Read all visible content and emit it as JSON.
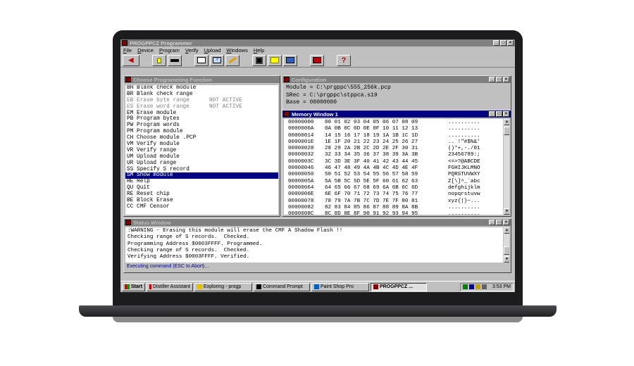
{
  "app": {
    "title": "PROGPPCZ Programmer",
    "menu": [
      "File",
      "Device",
      "Program",
      "Verify",
      "Upload",
      "Windows",
      "Help"
    ]
  },
  "toolbar": {
    "icons": [
      "back-arrow-icon",
      "bulb-icon",
      "bar-icon",
      "monitor-icon",
      "monitor-help-icon",
      "pencil-icon",
      "save-icon",
      "folder-open-icon",
      "transfer-icon",
      "export-icon",
      "help-icon"
    ]
  },
  "functions": {
    "title": "Choose Programming Function",
    "items": [
      {
        "text": "BH Blank check module",
        "state": "enabled"
      },
      {
        "text": "BR Blank check range",
        "state": "enabled"
      },
      {
        "text": "EB Erase byte range      NOT ACTIVE",
        "state": "disabled"
      },
      {
        "text": "ES Erase word range      NOT ACTIVE",
        "state": "disabled"
      },
      {
        "text": "EM Erase module",
        "state": "enabled"
      },
      {
        "text": "PB Program bytes",
        "state": "enabled"
      },
      {
        "text": "PW Program words",
        "state": "enabled"
      },
      {
        "text": "PM Program module",
        "state": "enabled"
      },
      {
        "text": "CH Choose module .PCP",
        "state": "enabled"
      },
      {
        "text": "VM Verify module",
        "state": "enabled"
      },
      {
        "text": "VR Verify range",
        "state": "enabled"
      },
      {
        "text": "UM Upload module",
        "state": "enabled"
      },
      {
        "text": "UR Upload range",
        "state": "enabled"
      },
      {
        "text": "SS Specify S record",
        "state": "enabled"
      },
      {
        "text": "SM Show module",
        "state": "selected"
      },
      {
        "text": "HE Help",
        "state": "enabled"
      },
      {
        "text": "QU Quit",
        "state": "enabled"
      },
      {
        "text": "RE Reset chip",
        "state": "enabled"
      },
      {
        "text": "BE Block Erase",
        "state": "enabled"
      },
      {
        "text": "CC CMF Censor",
        "state": "enabled"
      }
    ]
  },
  "configuration": {
    "title": "Configuration",
    "module": "Module = C:\\prgppc\\555_256k.pcp",
    "srec": "SRec = C:\\prgppc\\stppca.s19",
    "base": "Base = 00000000"
  },
  "memory": {
    "title": "Memory Window 1",
    "rows": [
      {
        "addr": "00000000",
        "hex": "00 01 02 03 04 05 06 07 08 09",
        "ascii": ".........."
      },
      {
        "addr": "0000000A",
        "hex": "0A 0B 0C 0D 0E 0F 10 11 12 13",
        "ascii": ".........."
      },
      {
        "addr": "00000014",
        "hex": "14 15 16 17 18 19 1A 1B 1C 1D",
        "ascii": ".........."
      },
      {
        "addr": "0000001E",
        "hex": "1E 1F 20 21 22 23 24 25 26 27",
        "ascii": ".. !\"#$%&'"
      },
      {
        "addr": "00000028",
        "hex": "28 29 2A 2B 2C 2D 2E 2F 30 31",
        "ascii": "()*+,-./01"
      },
      {
        "addr": "00000032",
        "hex": "32 33 34 35 36 37 38 39 3A 3B",
        "ascii": "23456789:;"
      },
      {
        "addr": "0000003C",
        "hex": "3C 3D 3E 3F 40 41 42 43 44 45",
        "ascii": "<=>?@ABCDE"
      },
      {
        "addr": "00000046",
        "hex": "46 47 48 49 4A 4B 4C 4D 4E 4F",
        "ascii": "FGHIJKLMNO"
      },
      {
        "addr": "00000050",
        "hex": "50 51 52 53 54 55 56 57 58 59",
        "ascii": "PQRSTUVWXY"
      },
      {
        "addr": "0000005A",
        "hex": "5A 5B 5C 5D 5E 5F 60 61 62 63",
        "ascii": "Z[\\]^_`abc"
      },
      {
        "addr": "00000064",
        "hex": "64 65 66 67 68 69 6A 6B 6C 6D",
        "ascii": "defghijklm"
      },
      {
        "addr": "0000006E",
        "hex": "6E 6F 70 71 72 73 74 75 76 77",
        "ascii": "nopqrstuvw"
      },
      {
        "addr": "00000078",
        "hex": "78 79 7A 7B 7C 7D 7E 7F 80 81",
        "ascii": "xyz{|}~..."
      },
      {
        "addr": "00000082",
        "hex": "82 83 84 85 86 87 88 89 8A 8B",
        "ascii": ".........."
      },
      {
        "addr": "0000008C",
        "hex": "8C 8D 8E 8F 90 91 92 93 94 95",
        "ascii": ".........."
      }
    ]
  },
  "status": {
    "title": "Status Window",
    "lines": [
      ":WARNING - Erasing this module will erase the CMF A Shadow Flash !!",
      "Checking range of S records.  Checked.",
      "Programming Address $0003FFFF. Programmed.",
      "Checking range of S records.  Checked.",
      "Verifying Address $0003FFFF. Verified."
    ],
    "footer": "Executing command (ESC to Abort)..."
  },
  "taskbar": {
    "start": "Start",
    "tasks": [
      "Distiller Assistant",
      "Exploring - progp",
      "Command Prompt",
      "Paint Shop Pro",
      "PROGPPCZ ..."
    ],
    "clock": "3:53 PM"
  }
}
